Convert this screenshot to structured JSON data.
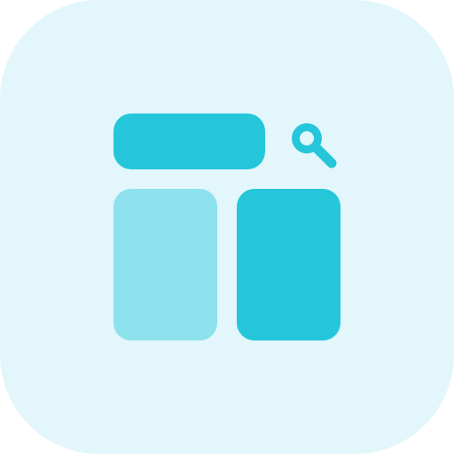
{
  "icon": {
    "name": "search-layout-icon",
    "colors": {
      "tile_background": "#e2f6fb",
      "primary": "#25c6da",
      "secondary": "#8ce1ec"
    },
    "parts": {
      "search_bar": "search-bar-shape",
      "search_symbol": "magnifier-icon",
      "left_panel": "left-panel-shape",
      "right_panel": "right-panel-shape"
    }
  }
}
